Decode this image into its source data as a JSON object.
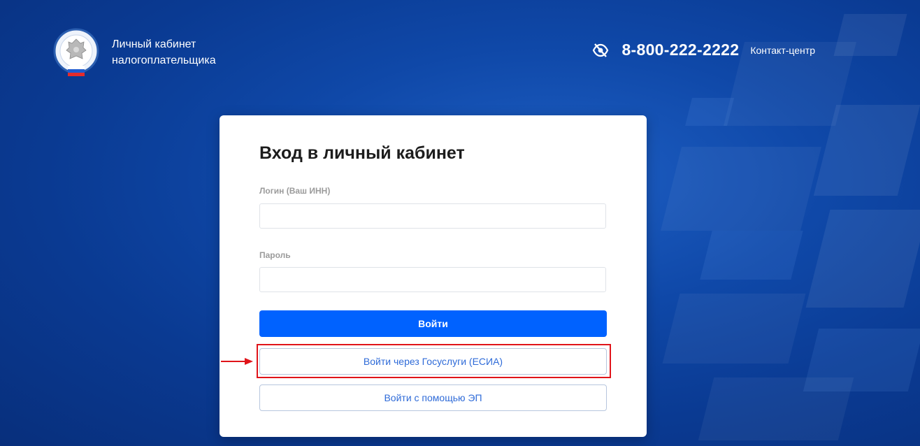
{
  "header": {
    "title_line1": "Личный кабинет",
    "title_line2": "налогоплательщика",
    "phone": "8-800-222-2222",
    "contact_label": "Контакт-центр",
    "accessibility_icon": "eye-slash-icon"
  },
  "login_card": {
    "heading": "Вход в личный кабинет",
    "login_label": "Логин (Ваш ИНН)",
    "login_value": "",
    "password_label": "Пароль",
    "password_value": "",
    "submit_label": "Войти",
    "gosuslugi_label": "Войти через Госуслуги (ЕСИА)",
    "ep_label": "Войти с помощью ЭП"
  },
  "annotation": {
    "arrow_icon": "arrow-right-icon",
    "highlight_color": "#e0141a"
  },
  "colors": {
    "background": "#0f48a8",
    "primary_button": "#0062ff",
    "link_text": "#2f6bd8"
  }
}
